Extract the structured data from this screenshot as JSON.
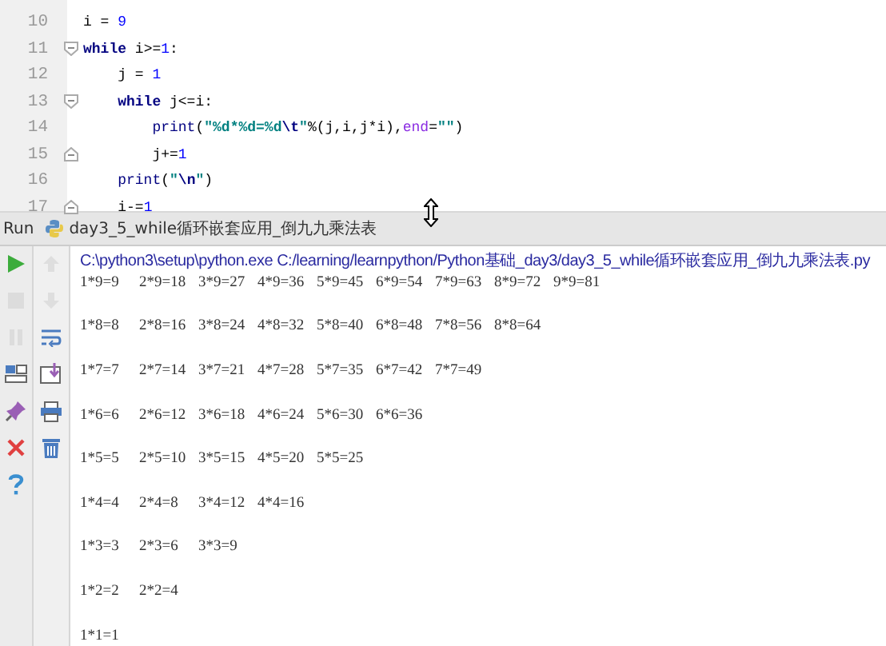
{
  "editor": {
    "lines": [
      {
        "number": "10",
        "fold_start": false,
        "fold_end": false,
        "tokens": [
          {
            "kind": "plain",
            "text": "i = "
          },
          {
            "kind": "number",
            "text": "9"
          }
        ]
      },
      {
        "number": "11",
        "fold_start": true,
        "fold_end": false,
        "tokens": [
          {
            "kind": "keyword",
            "text": "while"
          },
          {
            "kind": "plain",
            "text": " i>="
          },
          {
            "kind": "number",
            "text": "1"
          },
          {
            "kind": "plain",
            "text": ":"
          }
        ]
      },
      {
        "number": "12",
        "fold_start": false,
        "fold_end": false,
        "tokens": [
          {
            "kind": "plain",
            "text": "    j = "
          },
          {
            "kind": "number",
            "text": "1"
          }
        ]
      },
      {
        "number": "13",
        "fold_start": true,
        "fold_end": false,
        "tokens": [
          {
            "kind": "keyword",
            "text": "    while"
          },
          {
            "kind": "plain",
            "text": " j<=i:"
          }
        ]
      },
      {
        "number": "14",
        "fold_start": false,
        "fold_end": false,
        "tokens": [
          {
            "kind": "builtin",
            "text": "        print"
          },
          {
            "kind": "plain",
            "text": "("
          },
          {
            "kind": "string",
            "text": "\"%d*%d=%d"
          },
          {
            "kind": "escape",
            "text": "\\t"
          },
          {
            "kind": "string",
            "text": "\""
          },
          {
            "kind": "plain",
            "text": "%(j,i,j*i),"
          },
          {
            "kind": "kwarg",
            "text": "end"
          },
          {
            "kind": "plain",
            "text": "="
          },
          {
            "kind": "string",
            "text": "\"\""
          },
          {
            "kind": "plain",
            "text": ")"
          }
        ]
      },
      {
        "number": "15",
        "fold_start": false,
        "fold_end": true,
        "tokens": [
          {
            "kind": "plain",
            "text": "        j+="
          },
          {
            "kind": "number",
            "text": "1"
          }
        ]
      },
      {
        "number": "16",
        "fold_start": false,
        "fold_end": false,
        "tokens": [
          {
            "kind": "builtin",
            "text": "    print"
          },
          {
            "kind": "plain",
            "text": "("
          },
          {
            "kind": "string",
            "text": "\""
          },
          {
            "kind": "escape",
            "text": "\\n"
          },
          {
            "kind": "string",
            "text": "\""
          },
          {
            "kind": "plain",
            "text": ")"
          }
        ]
      },
      {
        "number": "17",
        "fold_start": false,
        "fold_end": true,
        "tokens": [
          {
            "kind": "plain",
            "text": "    i-="
          },
          {
            "kind": "number",
            "text": "1"
          }
        ]
      }
    ]
  },
  "run_panel": {
    "label": "Run",
    "tab_title": "day3_5_while循环嵌套应用_倒九九乘法表",
    "left_tools": [
      {
        "kind": "run",
        "disabled": false
      },
      {
        "kind": "stop",
        "disabled": true
      },
      {
        "kind": "pause",
        "disabled": true
      },
      {
        "kind": "layout",
        "disabled": false
      },
      {
        "kind": "pin",
        "disabled": false
      },
      {
        "kind": "close",
        "disabled": false
      },
      {
        "kind": "help",
        "disabled": false
      }
    ],
    "right_tools": [
      {
        "kind": "up",
        "disabled": true
      },
      {
        "kind": "down",
        "disabled": true
      },
      {
        "kind": "wrap",
        "disabled": false
      },
      {
        "kind": "scroll-end",
        "disabled": false
      },
      {
        "kind": "print",
        "disabled": false
      },
      {
        "kind": "trash",
        "disabled": false
      }
    ],
    "command": "C:\\python3\\setup\\python.exe C:/learning/learnpython/Python基础_day3/day3_5_while循环嵌套应用_倒九九乘法表.py",
    "output_rows": [
      [
        "1*9=9",
        "2*9=18",
        "3*9=27",
        "4*9=36",
        "5*9=45",
        "6*9=54",
        "7*9=63",
        "8*9=72",
        "9*9=81"
      ],
      [
        "1*8=8",
        "2*8=16",
        "3*8=24",
        "4*8=32",
        "5*8=40",
        "6*8=48",
        "7*8=56",
        "8*8=64"
      ],
      [
        "1*7=7",
        "2*7=14",
        "3*7=21",
        "4*7=28",
        "5*7=35",
        "6*7=42",
        "7*7=49"
      ],
      [
        "1*6=6",
        "2*6=12",
        "3*6=18",
        "4*6=24",
        "5*6=30",
        "6*6=36"
      ],
      [
        "1*5=5",
        "2*5=10",
        "3*5=15",
        "4*5=20",
        "5*5=25"
      ],
      [
        "1*4=4",
        "2*4=8",
        "3*4=12",
        "4*4=16"
      ],
      [
        "1*3=3",
        "2*3=6",
        "3*3=9"
      ],
      [
        "1*2=2",
        "2*2=4"
      ],
      [
        "1*1=1"
      ]
    ]
  }
}
